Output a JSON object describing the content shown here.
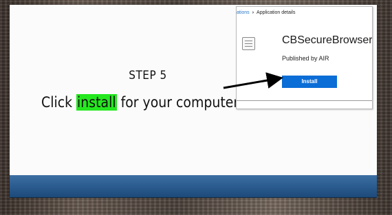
{
  "slide": {
    "step_label": "STEP 5",
    "instruction_before": "Click ",
    "instruction_highlight": "install",
    "instruction_after": " for your computer"
  },
  "screenshot": {
    "breadcrumb_prev": "ations",
    "breadcrumb_current": "Application details",
    "app_name": "CBSecureBrowser",
    "publisher": "Published by AIR",
    "install_button": "Install"
  },
  "colors": {
    "highlight": "#25e81f",
    "install_button": "#0b6dd6",
    "band": "#2a5a8e"
  }
}
